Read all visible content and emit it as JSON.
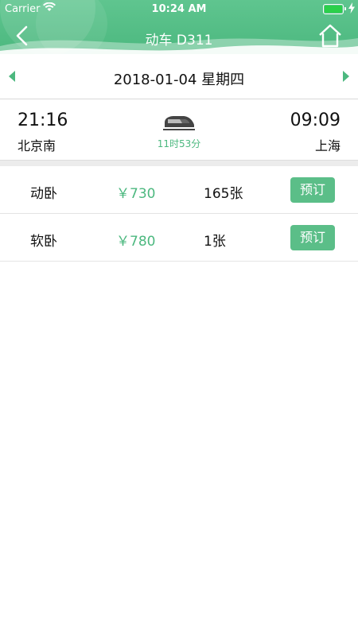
{
  "status_bar": {
    "carrier": "Carrier",
    "time": "10:24 AM",
    "wifi_icon": "wifi-icon",
    "battery_icon": "battery-icon",
    "charging_icon": "charging-bolt-icon"
  },
  "nav": {
    "title": "动车 D311",
    "back_icon": "back-chevron-icon",
    "home_icon": "home-icon"
  },
  "date_bar": {
    "date": "2018-01-04 星期四",
    "prev_icon": "prev-day-triangle-icon",
    "next_icon": "next-day-triangle-icon"
  },
  "train": {
    "departure_time": "21:16",
    "departure_station": "北京南",
    "arrival_time": "09:09",
    "arrival_station": "上海",
    "duration": "11时53分",
    "train_icon": "high-speed-train-icon"
  },
  "seats": [
    {
      "type": "动卧",
      "price": "￥730",
      "count": "165张",
      "book_label": "预订"
    },
    {
      "type": "软卧",
      "price": "￥780",
      "count": "1张",
      "book_label": "预订"
    }
  ],
  "colors": {
    "accent": "#4cb87f",
    "header": "#5fc58f",
    "button": "#5bbe88"
  }
}
